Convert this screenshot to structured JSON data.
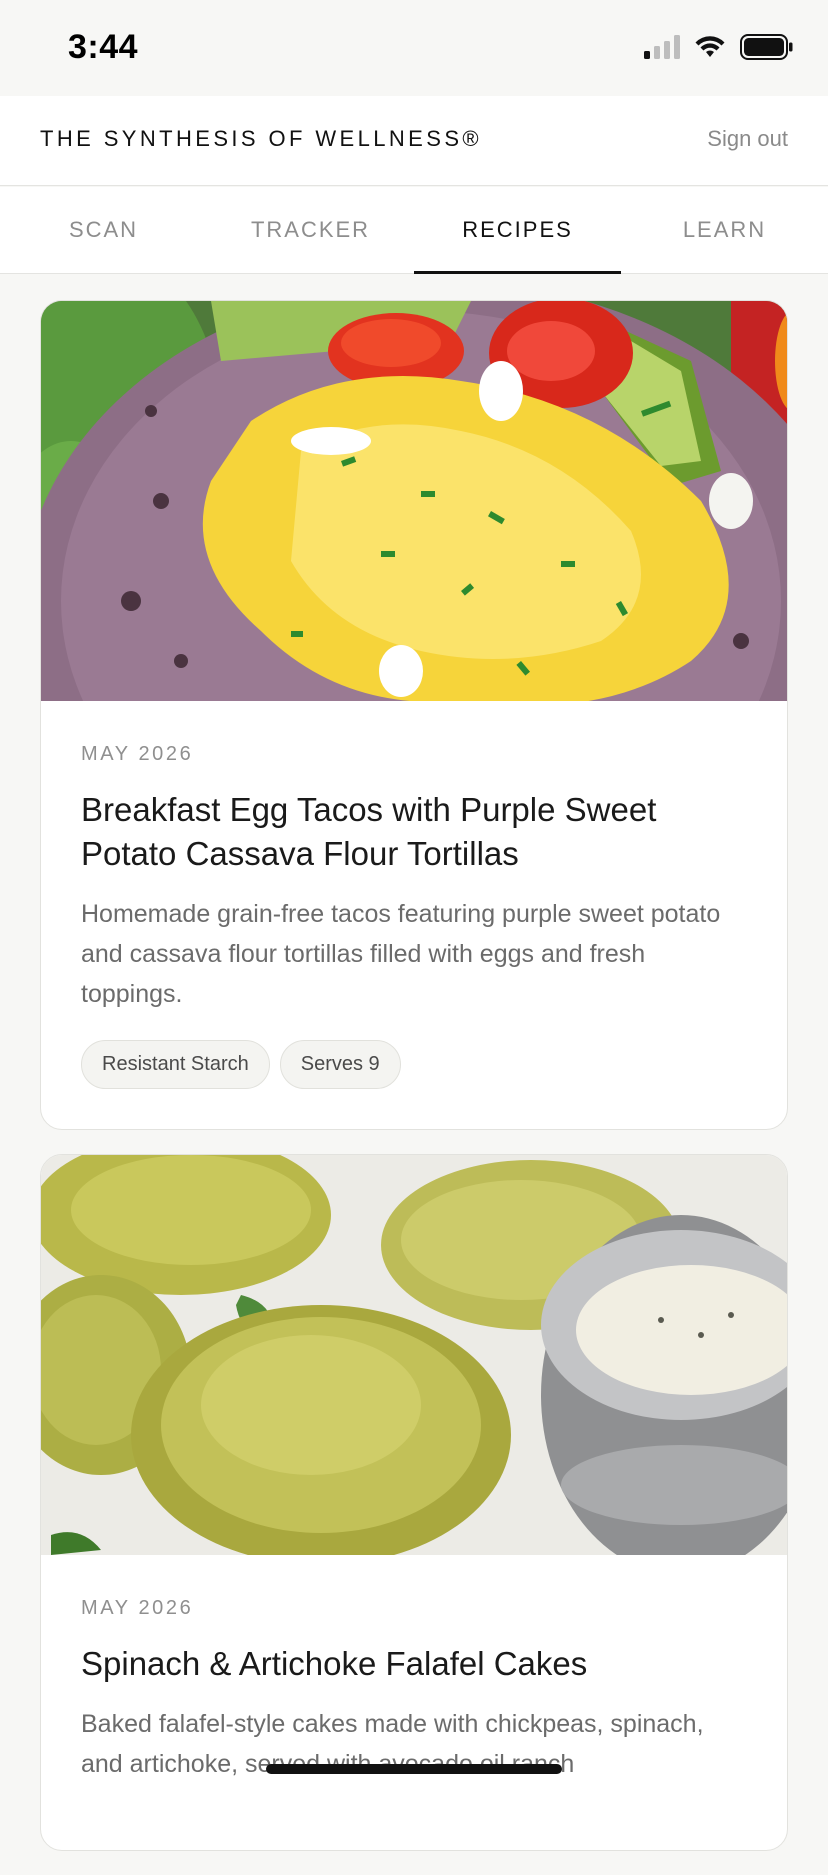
{
  "status_bar": {
    "time": "3:44",
    "icons": [
      "cellular-signal-icon",
      "wifi-icon",
      "battery-icon"
    ]
  },
  "header": {
    "brand": "THE SYNTHESIS OF WELLNESS®",
    "sign_out": "Sign out"
  },
  "tabs": [
    {
      "label": "SCAN",
      "active": false
    },
    {
      "label": "TRACKER",
      "active": false
    },
    {
      "label": "RECIPES",
      "active": true
    },
    {
      "label": "LEARN",
      "active": false
    }
  ],
  "recipes": [
    {
      "date": "MAY 2026",
      "title": "Breakfast Egg Tacos with Purple Sweet Potato Cassava Flour Tortillas",
      "description": "Homemade grain-free tacos featuring purple sweet potato and cassava flour tortillas filled with eggs and fresh toppings.",
      "tags": [
        "Resistant Starch",
        "Serves 9"
      ],
      "image": "egg-tacos-photo"
    },
    {
      "date": "MAY 2026",
      "title": "Spinach & Artichoke Falafel Cakes",
      "description": "Baked falafel-style cakes made with chickpeas, spinach, and artichoke, served with avocado oil ranch",
      "tags": [],
      "image": "falafel-cakes-photo"
    }
  ],
  "colors": {
    "background": "#f7f7f5",
    "card": "#ffffff",
    "accent": "#111111",
    "muted": "#8d8d8d"
  }
}
